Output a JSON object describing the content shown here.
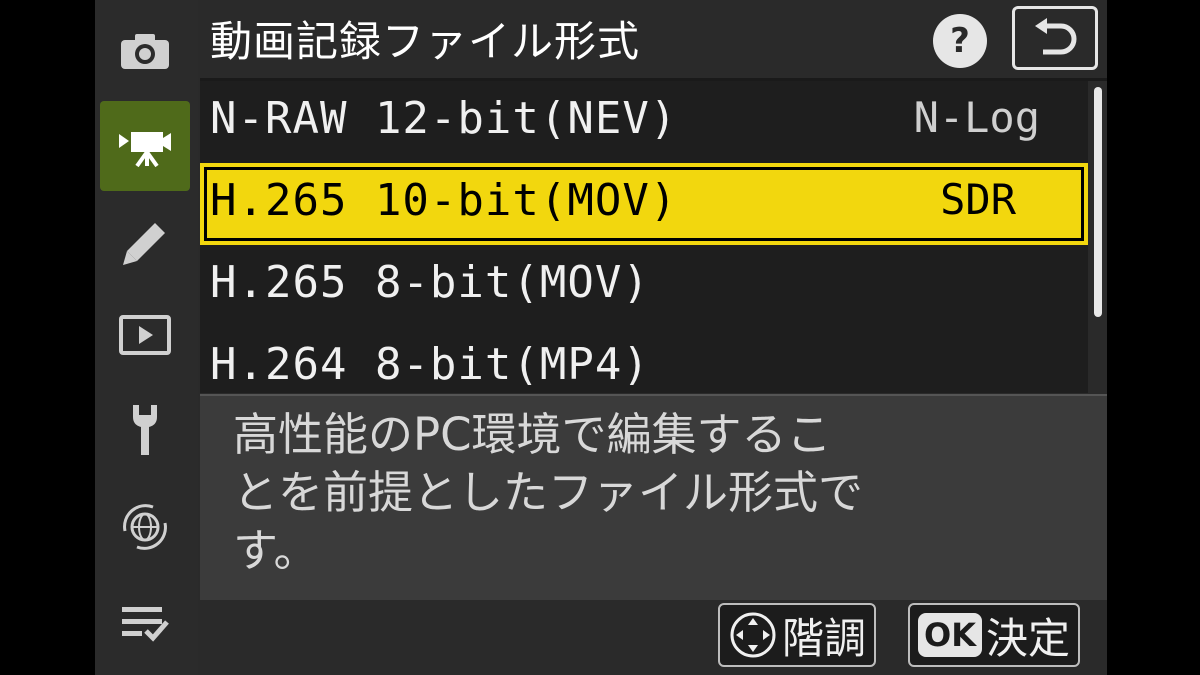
{
  "header": {
    "title": "動画記録ファイル形式",
    "help_icon": "question-icon",
    "back_icon": "return-arrow-icon"
  },
  "sidebar": {
    "items": [
      {
        "icon": "camera-icon",
        "active": false
      },
      {
        "icon": "movie-camera-icon",
        "active": true
      },
      {
        "icon": "pencil-icon",
        "active": false
      },
      {
        "icon": "playback-icon",
        "active": false
      },
      {
        "icon": "wrench-icon",
        "active": false
      },
      {
        "icon": "network-globe-icon",
        "active": false
      },
      {
        "icon": "my-menu-icon",
        "active": false
      }
    ],
    "active_color": "#4f6a1a"
  },
  "options": [
    {
      "label": "N-RAW 12-bit(NEV)",
      "tag": "N-Log",
      "selected": false
    },
    {
      "label": "H.265 10-bit(MOV)",
      "tag": "SDR",
      "selected": true
    },
    {
      "label": "H.265 8-bit(MOV)",
      "tag": "",
      "selected": false
    },
    {
      "label": "H.264 8-bit(MP4)",
      "tag": "",
      "selected": false
    }
  ],
  "highlight_color": "#f2d70e",
  "description": "高性能のPC環境で編集することを前提としたファイル形式です。",
  "footer": {
    "tone_label": "階調",
    "tone_icon": "multi-selector-icon",
    "ok_badge": "OK",
    "confirm_label": "決定"
  }
}
